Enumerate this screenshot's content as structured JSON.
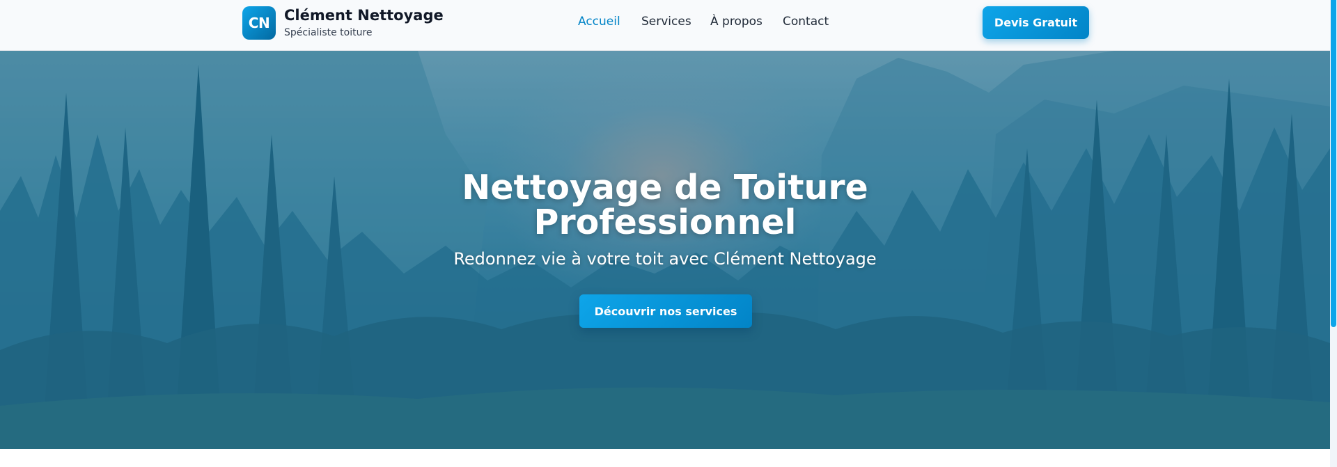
{
  "brand": {
    "initials": "CN",
    "name": "Clément Nettoyage",
    "tagline": "Spécialiste toiture"
  },
  "nav": {
    "items": [
      {
        "label": "Accueil",
        "active": true
      },
      {
        "label": "Services",
        "active": false
      },
      {
        "label": "À propos",
        "active": false
      },
      {
        "label": "Contact",
        "active": false
      }
    ]
  },
  "header_cta": {
    "label": "Devis Gratuit"
  },
  "hero": {
    "title_line1": "Nettoyage de Toiture",
    "title_line2": "Professionnel",
    "subtitle": "Redonnez vie à votre toit avec Clément Nettoyage",
    "button_label": "Découvrir nos services"
  },
  "colors": {
    "accent": "#0ea5e9",
    "accent_dark": "#0284c7",
    "text_dark": "#111827"
  }
}
